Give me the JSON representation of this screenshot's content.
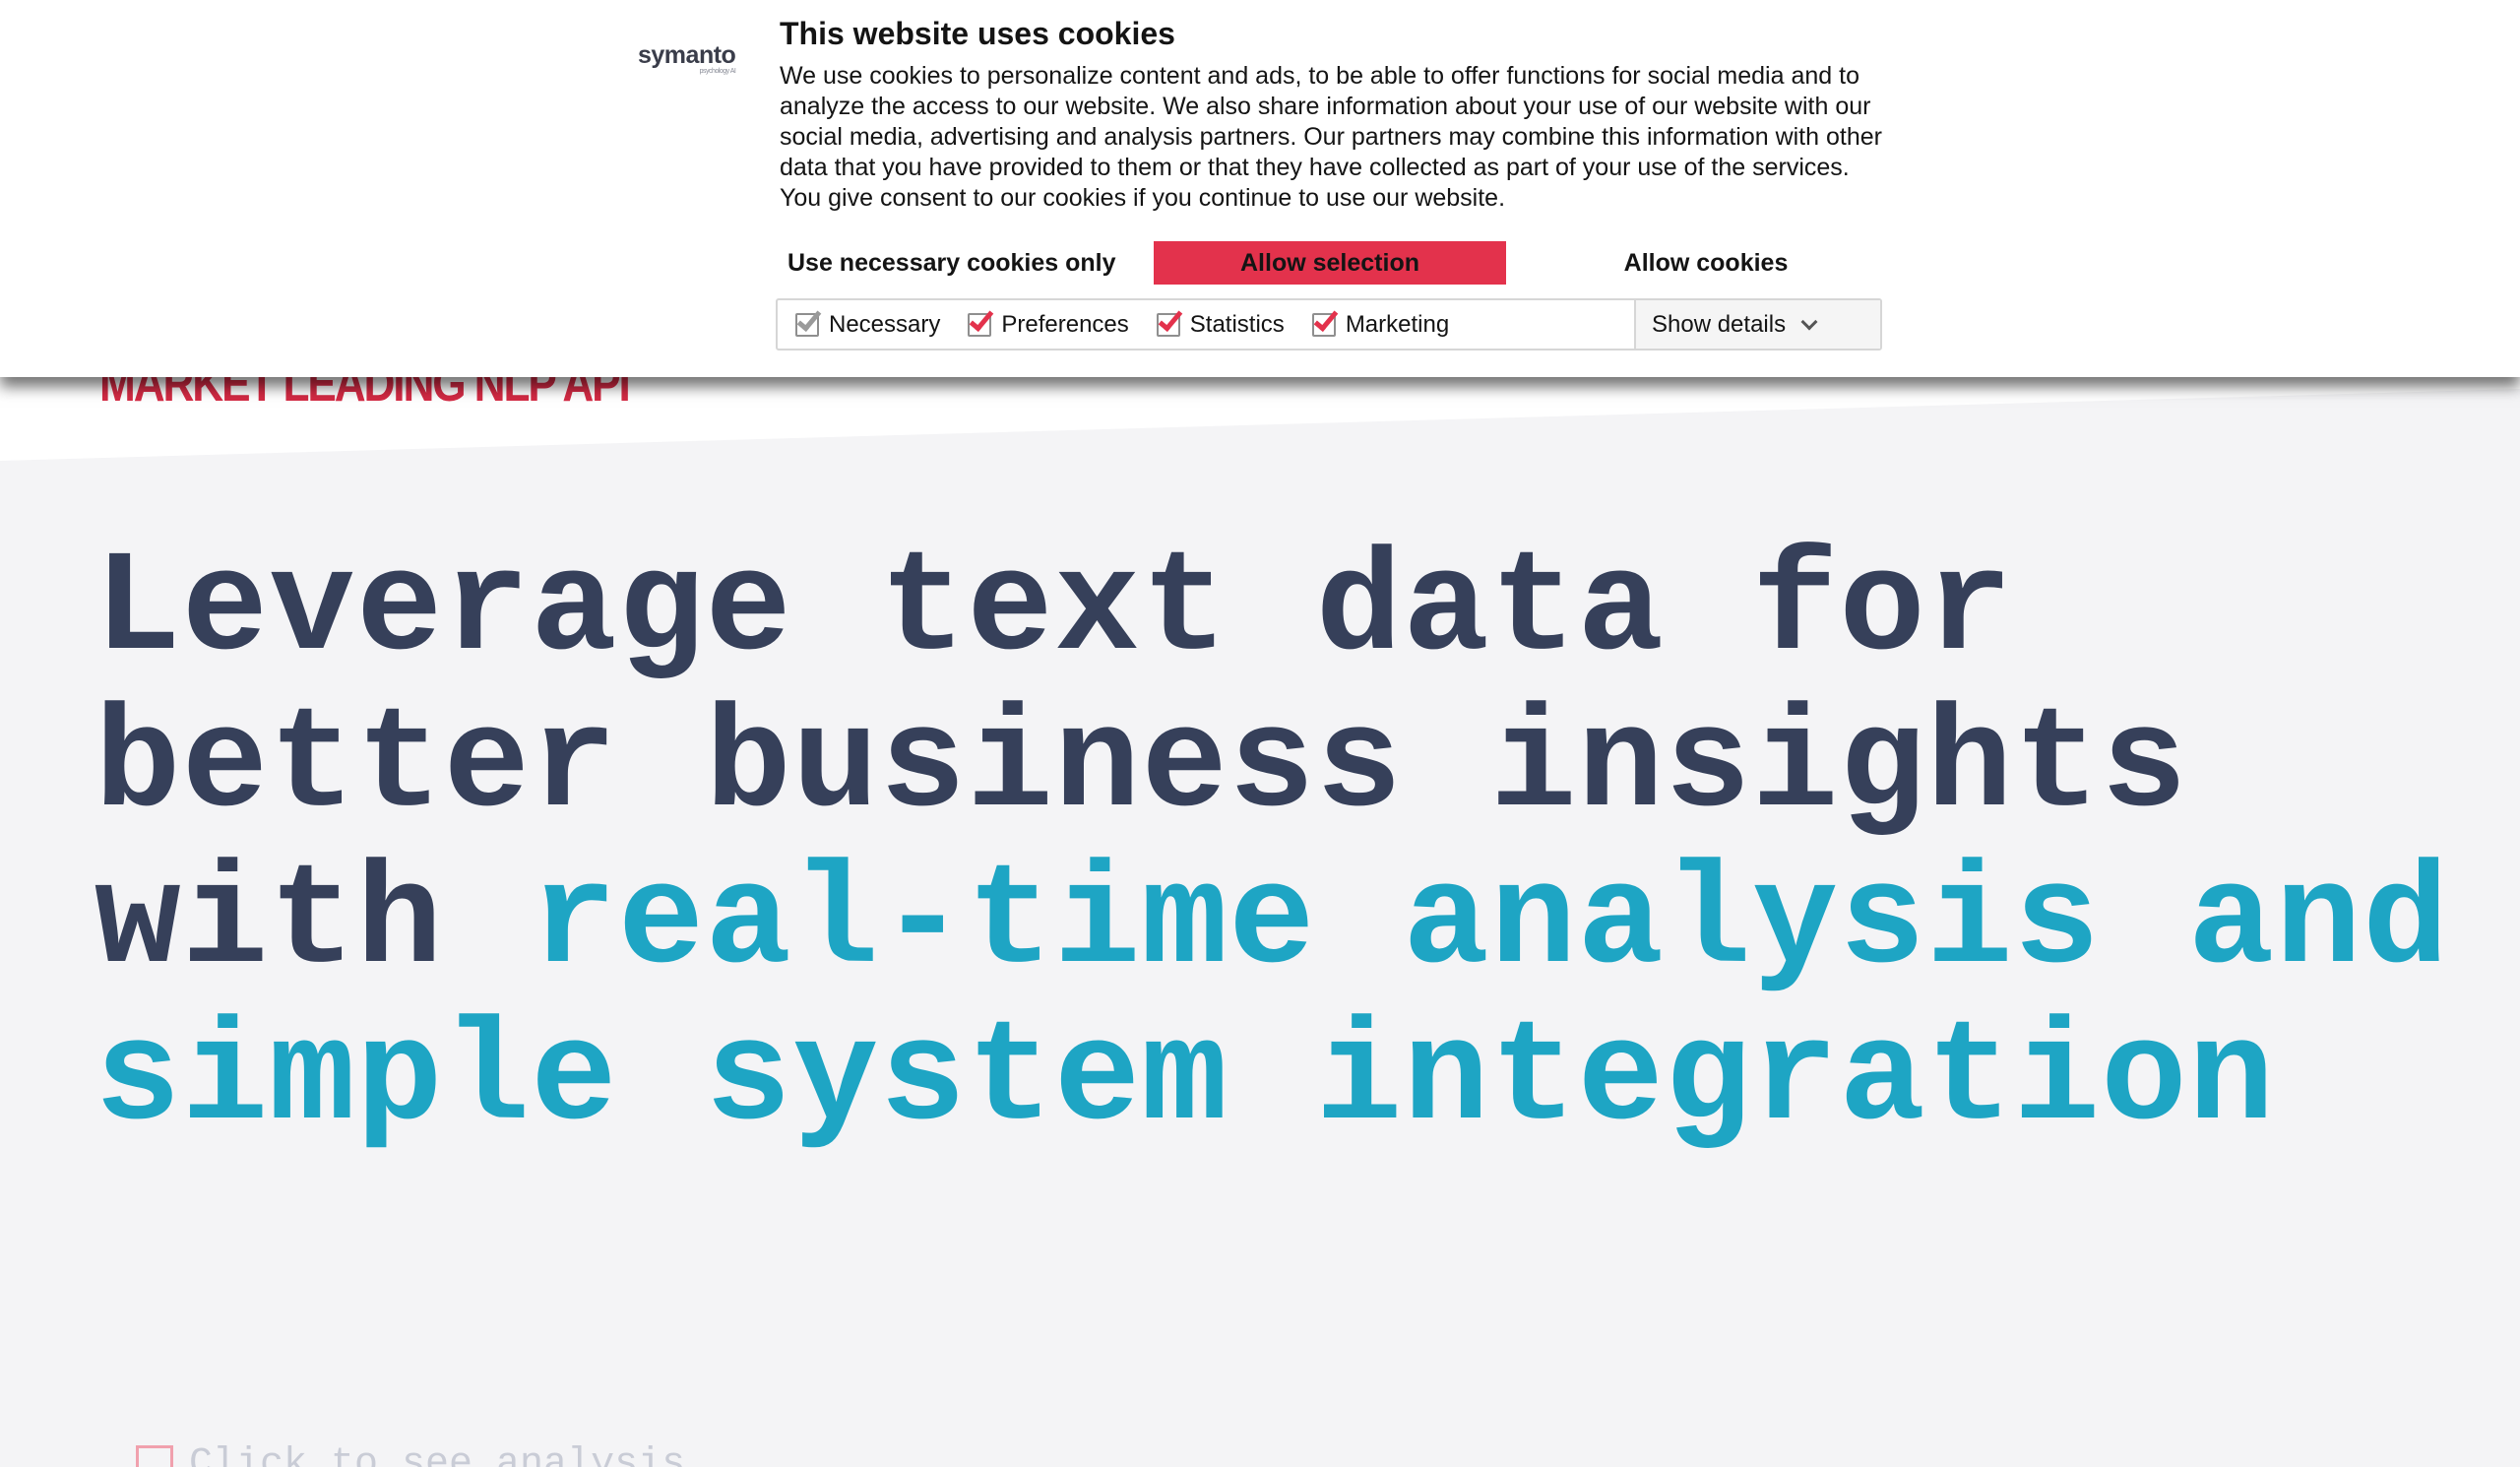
{
  "page": {
    "eyebrow": "Market Leading NLP API",
    "headline_dark_1": "Leverage text data for better business insights with ",
    "headline_highlight": "real-time analysis and simple system integration",
    "analysis_hint": "Click to see analysis"
  },
  "cookie_banner": {
    "logo_text": "symanto",
    "logo_tagline": "psychology AI",
    "title": "This website uses cookies",
    "body": "We use cookies to personalize content and ads, to be able to offer functions for social media and to analyze the access to our website. We also share information about your use of our website with our social media, advertising and analysis partners. Our partners may combine this information with other data that you have provided to them or that they have collected as part of your use of the services. You give consent to our cookies if you continue to use our website.",
    "buttons": {
      "necessary_only": "Use necessary cookies only",
      "allow_selection": "Allow selection",
      "allow_all": "Allow cookies"
    },
    "options": [
      {
        "label": "Necessary",
        "checked": true,
        "disabled": true
      },
      {
        "label": "Preferences",
        "checked": true
      },
      {
        "label": "Statistics",
        "checked": true
      },
      {
        "label": "Marketing",
        "checked": true
      }
    ],
    "show_details": "Show details"
  },
  "colors": {
    "accent_red": "#e3324c",
    "headline_dark": "#36405a",
    "headline_teal": "#1ea5c4",
    "eyebrow_red": "#d42a44"
  }
}
